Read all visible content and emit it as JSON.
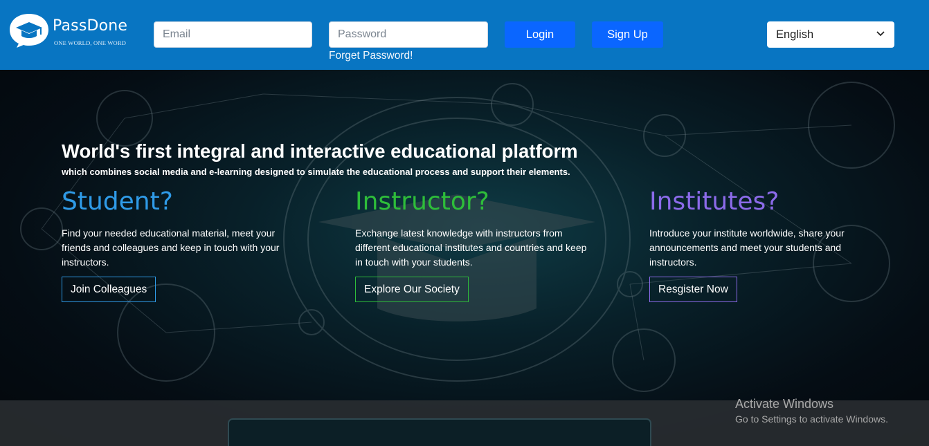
{
  "header": {
    "brand": {
      "name": "PassDone",
      "tagline": "ONE WORLD, ONE WORD"
    },
    "email": {
      "placeholder": "Email",
      "value": ""
    },
    "password": {
      "placeholder": "Password",
      "value": ""
    },
    "forget_label": "Forget Password!",
    "login_label": "Login",
    "signup_label": "Sign Up",
    "language": {
      "selected": "English"
    }
  },
  "hero": {
    "title": "World's first integral and interactive educational platform",
    "subtitle": "which combines social media and e-learning designed to simulate the educational process and support their elements.",
    "columns": [
      {
        "heading": "Student?",
        "color": "#2f9be8",
        "text": "Find your needed educational material, meet your friends and colleagues and keep in touch with your instructors.",
        "button": "Join Colleagues"
      },
      {
        "heading": "Instructor?",
        "color": "#2ebd3a",
        "text": "Exchange latest knowledge with instructors from different educational institutes and countries and keep in touch with your students.",
        "button": "Explore Our Society"
      },
      {
        "heading": "Institutes?",
        "color": "#8c6bea",
        "text": "Introduce your institute worldwide, share your announcements and meet your students and instructors.",
        "button": "Resgister Now"
      }
    ]
  },
  "watermark": {
    "title": "Activate Windows",
    "subtitle": "Go to Settings to activate Windows."
  },
  "colors": {
    "header_bg": "#0875c2",
    "button_bg": "#0a66ff"
  },
  "icons": [
    "passdone-logo-icon",
    "chevron-down-icon"
  ]
}
